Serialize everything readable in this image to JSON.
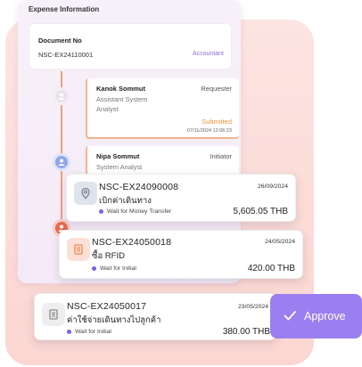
{
  "panel": {
    "title": "Expense Information",
    "document_label": "Document No",
    "document_no": "NSC-EX24110001",
    "document_role": "Accountant"
  },
  "timeline": [
    {
      "name": "Kanok Sommut",
      "role": "Requester",
      "position_line1": "Assistant System",
      "position_line2": "Analyst",
      "status": "Submitted",
      "date": "07/11/2024 12:06:23"
    },
    {
      "name": "Nipa Sommut",
      "role": "Initiator",
      "position_line1": "System Analyst"
    }
  ],
  "cards": [
    {
      "doc_no": "NSC-EX24090008",
      "description": "เบิกค่าเดินทาง",
      "date": "26/09/2024",
      "status": "Wait for Money Transfer",
      "amount": "5,605.05 THB",
      "icon": "location-pin-icon",
      "icon_color": "#dfe3ec"
    },
    {
      "doc_no": "NSC-EX24050018",
      "description": "ซื้อ RFID",
      "date": "24/05/2024",
      "status": "Wait for Initial",
      "amount": "420.00 THB",
      "icon": "receipt-icon",
      "icon_color": "#fbe1d5"
    },
    {
      "doc_no": "NSC-EX24050017",
      "description": "ค่าใช้จ่ายเดินทางไปลูกค้า",
      "date": "23/05/2024",
      "status": "Wait for Initial",
      "amount": "380.00 THB",
      "icon": "document-icon",
      "icon_color": "#eeeeee"
    }
  ],
  "approve_button": {
    "label": "Approve",
    "icon": "checkmark-icon"
  },
  "colors": {
    "accent": "#9b7ff0",
    "status_dot": "#7b61e0",
    "submitted": "#f0963f",
    "timeline": "#f0a07a"
  }
}
